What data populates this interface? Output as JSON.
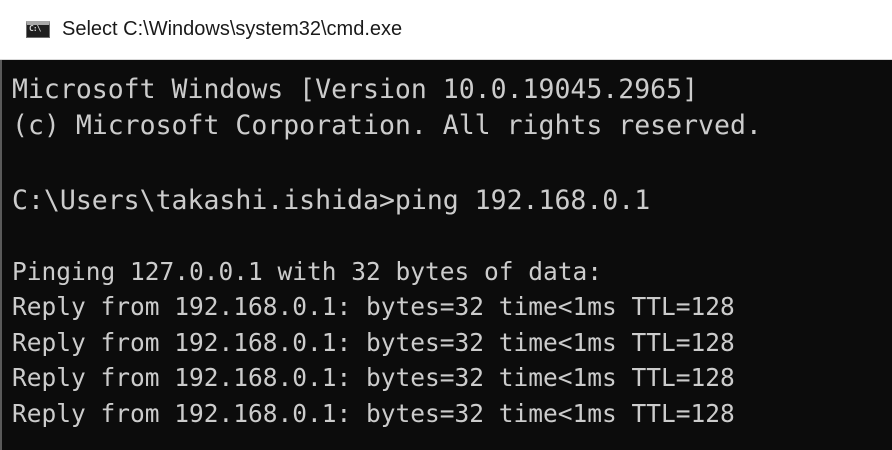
{
  "window": {
    "title": "Select C:\\Windows\\system32\\cmd.exe",
    "icon": "console-app-icon",
    "icon_glyph": "C:\\",
    "console_background": "#0c0c0c",
    "console_text_color": "#cccccc"
  },
  "console": {
    "lines": [
      "Microsoft Windows [Version 10.0.19045.2965]",
      "(c) Microsoft Corporation. All rights reserved.",
      "",
      "C:\\Users\\takashi.ishida>ping 192.168.0.1",
      "",
      "Pinging 127.0.0.1 with 32 bytes of data:",
      "Reply from 192.168.0.1: bytes=32 time<1ms TTL=128",
      "Reply from 192.168.0.1: bytes=32 time<1ms TTL=128",
      "Reply from 192.168.0.1: bytes=32 time<1ms TTL=128",
      "Reply from 192.168.0.1: bytes=32 time<1ms TTL=128"
    ]
  }
}
